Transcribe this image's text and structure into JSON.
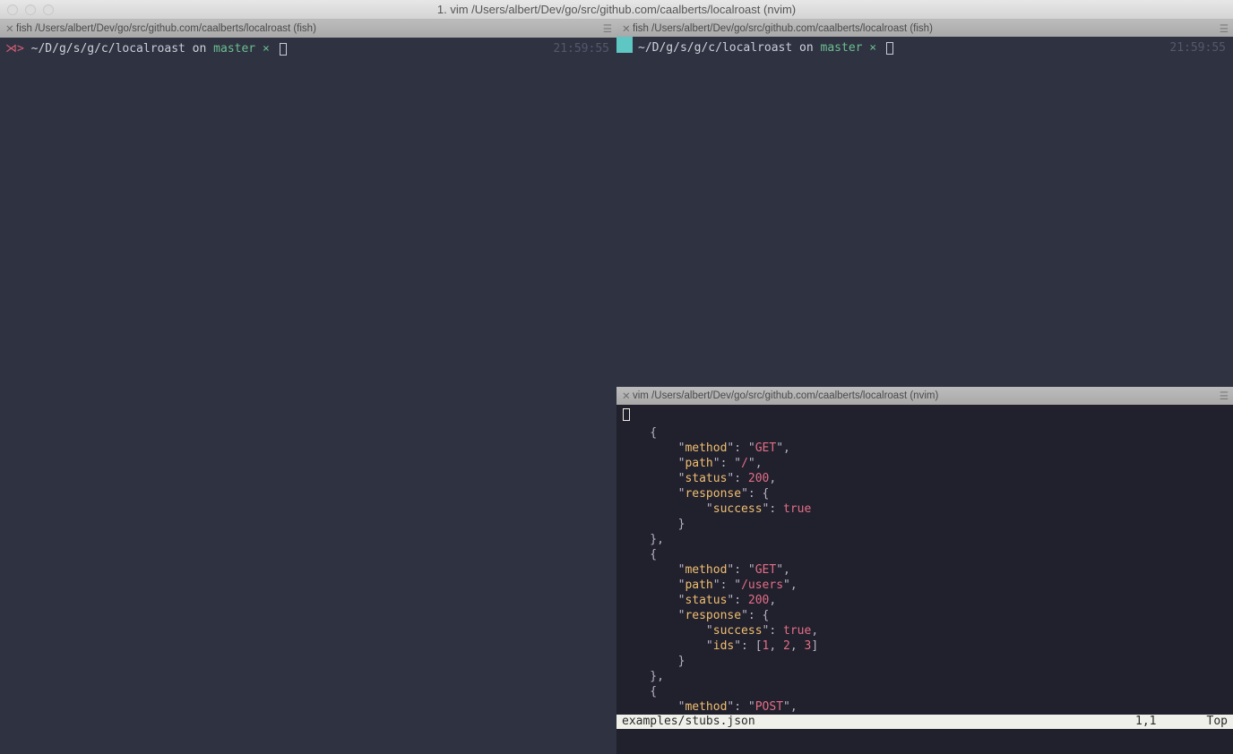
{
  "window": {
    "title": "1. vim  /Users/albert/Dev/go/src/github.com/caalberts/localroast (nvim)"
  },
  "left": {
    "tab": {
      "label": "fish  /Users/albert/Dev/go/src/github.com/caalberts/localroast (fish)"
    },
    "prompt": {
      "arrow": "⋊>",
      "path": "~/D/g/s/g/c/",
      "dirname": "localroast",
      "on": " on ",
      "branch": "master",
      "star": " ⨯",
      "time": "21:59:55"
    }
  },
  "right": {
    "top_tab": {
      "label": "fish  /Users/albert/Dev/go/src/github.com/caalberts/localroast (fish)"
    },
    "prompt": {
      "arrow": "",
      "path": "~/D/g/s/g/c/",
      "dirname": "localroast",
      "on": " on ",
      "branch": "master",
      "star": " ⨯",
      "time": "21:59:55"
    },
    "vim_tab": {
      "label": "vim  /Users/albert/Dev/go/src/github.com/caalberts/localroast (nvim)"
    },
    "vim_status": {
      "file": "examples/stubs.json",
      "pos": "1,1",
      "scroll": "Top"
    },
    "code": {
      "l1": "    {",
      "l2a": "        \"",
      "l2b": "method",
      "l2c": "\": \"",
      "l2d": "GET",
      "l2e": "\",",
      "l3a": "        \"",
      "l3b": "path",
      "l3c": "\": \"",
      "l3d": "/",
      "l3e": "\",",
      "l4a": "        \"",
      "l4b": "status",
      "l4c": "\": ",
      "l4d": "200",
      "l4e": ",",
      "l5a": "        \"",
      "l5b": "response",
      "l5c": "\": {",
      "l6a": "            \"",
      "l6b": "success",
      "l6c": "\": ",
      "l6d": "true",
      "l7": "        }",
      "l8": "    },",
      "l9": "    {",
      "l10a": "        \"",
      "l10b": "method",
      "l10c": "\": \"",
      "l10d": "GET",
      "l10e": "\",",
      "l11a": "        \"",
      "l11b": "path",
      "l11c": "\": \"",
      "l11d": "/users",
      "l11e": "\",",
      "l12a": "        \"",
      "l12b": "status",
      "l12c": "\": ",
      "l12d": "200",
      "l12e": ",",
      "l13a": "        \"",
      "l13b": "response",
      "l13c": "\": {",
      "l14a": "            \"",
      "l14b": "success",
      "l14c": "\": ",
      "l14d": "true",
      "l14e": ",",
      "l15a": "            \"",
      "l15b": "ids",
      "l15c": "\": [",
      "l15d": "1",
      "l15e": ", ",
      "l15f": "2",
      "l15g": ", ",
      "l15h": "3",
      "l15i": "]",
      "l16": "        }",
      "l17": "    },",
      "l18": "    {",
      "l19a": "        \"",
      "l19b": "method",
      "l19c": "\": \"",
      "l19d": "POST",
      "l19e": "\","
    }
  }
}
